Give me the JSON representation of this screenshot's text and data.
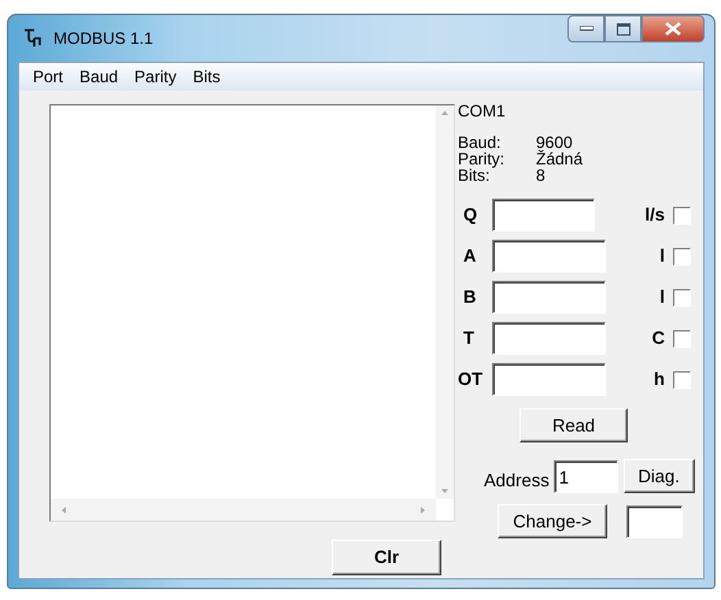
{
  "window": {
    "title": "MODBUS 1.1"
  },
  "menu": [
    {
      "label": "Port"
    },
    {
      "label": "Baud"
    },
    {
      "label": "Parity"
    },
    {
      "label": "Bits"
    }
  ],
  "port": "COM1",
  "settings": [
    {
      "label": "Baud:",
      "value": "9600"
    },
    {
      "label": "Parity:",
      "value": "Žádná"
    },
    {
      "label": "Bits:",
      "value": "8"
    }
  ],
  "channels": [
    {
      "label": "Q",
      "unit": "l/s",
      "checked": false
    },
    {
      "label": "A",
      "unit": "l",
      "checked": false
    },
    {
      "label": "B",
      "unit": "l",
      "checked": false
    },
    {
      "label": "T",
      "unit": "C",
      "checked": false
    },
    {
      "label": "OT",
      "unit": "h",
      "checked": false
    }
  ],
  "read_button": "Read",
  "address": {
    "label": "Address",
    "value": "1"
  },
  "diag_button": "Diag.",
  "change_button": "Change->",
  "clear_button": "Clr"
}
